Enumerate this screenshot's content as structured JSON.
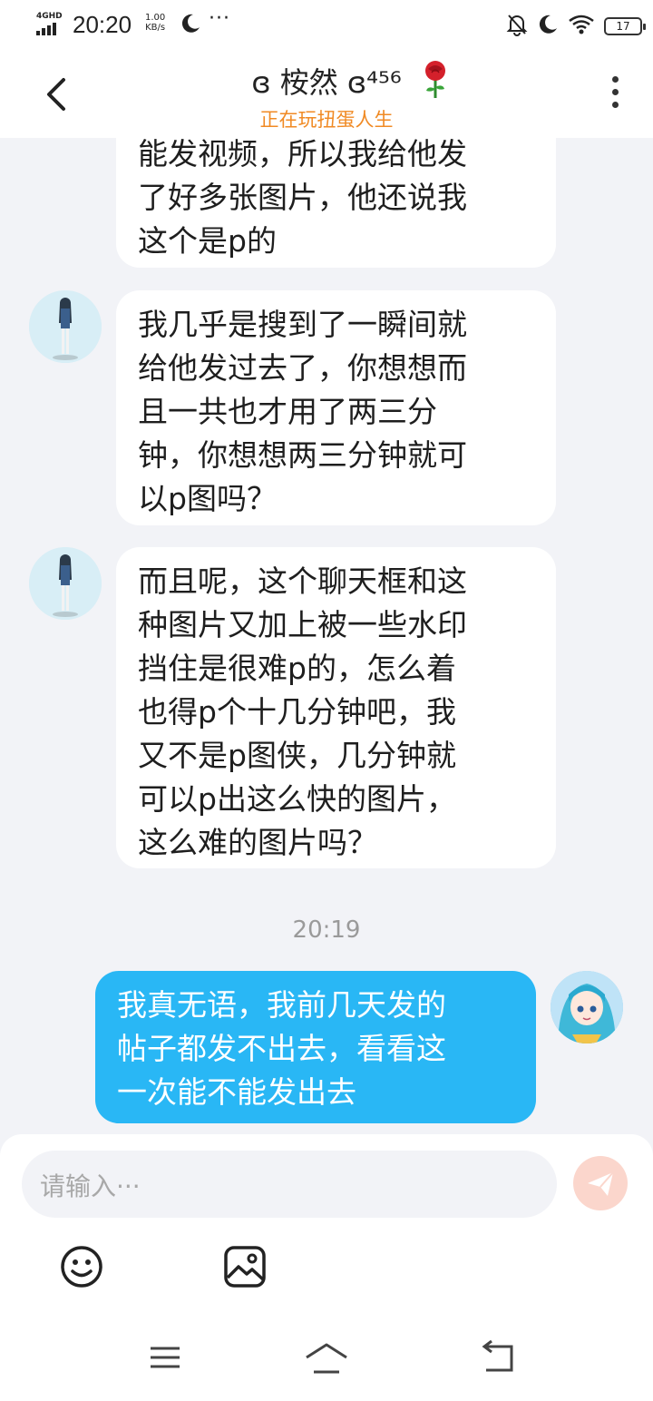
{
  "status_bar": {
    "network": "4GHD",
    "time": "20:20",
    "speed_value": "1.00",
    "speed_unit": "KB/s",
    "dots": "···",
    "battery": "17"
  },
  "header": {
    "title": "ɞ 桉然 ɞ⁴⁵⁶",
    "subtitle": "正在玩扭蛋人生"
  },
  "messages": [
    {
      "lines": [
        "能发视频，所以我给他发",
        "了好多张图片，他还说我",
        "这个是p的"
      ]
    },
    {
      "lines": [
        "我几乎是搜到了一瞬间就",
        "给他发过去了，你想想而",
        "且一共也才用了两三分",
        "钟，你想想两三分钟就可",
        "以p图吗？"
      ]
    },
    {
      "lines": [
        "而且呢，这个聊天框和这",
        "种图片又加上被一些水印",
        "挡住是很难p的，怎么着",
        "也得p个十几分钟吧，我",
        "又不是p图侠，几分钟就",
        "可以p出这么快的图片，",
        "这么难的图片吗？"
      ]
    }
  ],
  "timestamp": "20:19",
  "my_message": {
    "lines": [
      "我真无语，我前几天发的",
      "帖子都发不出去，看看这",
      "一次能不能发出去"
    ]
  },
  "input": {
    "placeholder": "请输入···"
  },
  "colors": {
    "accent": "#29b7f5",
    "subtitle": "#f08a24",
    "send": "#f7a08c"
  }
}
